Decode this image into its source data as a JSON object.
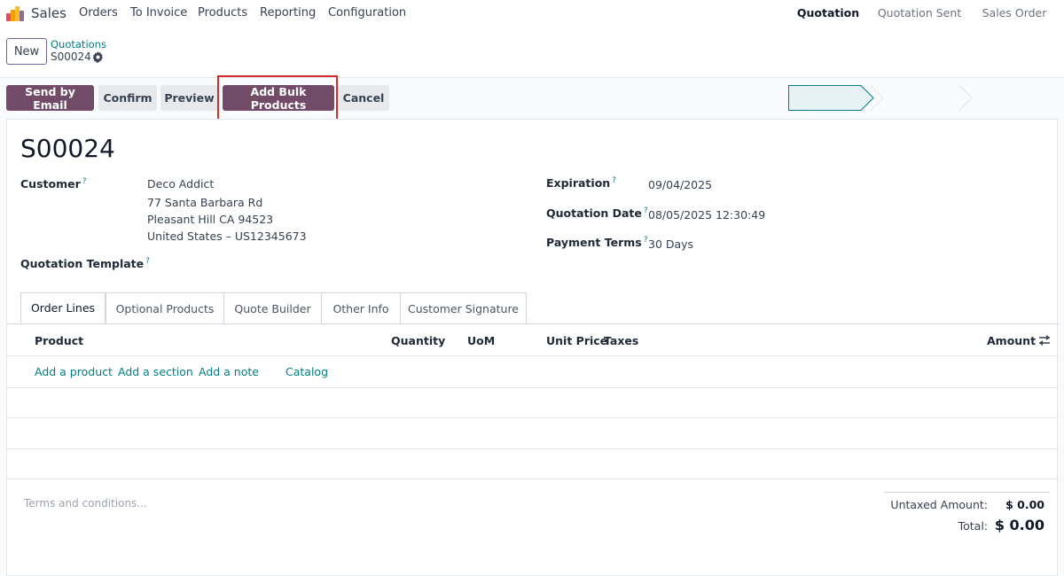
{
  "app": {
    "name": "Sales"
  },
  "nav": [
    "Orders",
    "To Invoice",
    "Products",
    "Reporting",
    "Configuration"
  ],
  "control": {
    "new_label": "New",
    "breadcrumb_parent": "Quotations",
    "breadcrumb_current": "S00024"
  },
  "actions": {
    "send_by_email": "Send by Email",
    "confirm": "Confirm",
    "preview": "Preview",
    "add_bulk_products": "Add Bulk Products",
    "cancel": "Cancel"
  },
  "status_stages": [
    "Quotation",
    "Quotation Sent",
    "Sales Order"
  ],
  "record": {
    "name": "S00024",
    "customer_label": "Customer",
    "customer_name": "Deco Addict",
    "address_line1": "77 Santa Barbara Rd",
    "address_line2": "Pleasant Hill CA 94523",
    "address_line3": "United States – US12345673",
    "template_label": "Quotation Template",
    "expiration_label": "Expiration",
    "expiration_value": "09/04/2025",
    "quotation_date_label": "Quotation Date",
    "quotation_date_value": "08/05/2025 12:30:49",
    "payment_terms_label": "Payment Terms",
    "payment_terms_value": "30 Days",
    "help_mark": "?"
  },
  "tabs": [
    "Order Lines",
    "Optional Products",
    "Quote Builder",
    "Other Info",
    "Customer Signature"
  ],
  "table": {
    "columns": {
      "product": "Product",
      "quantity": "Quantity",
      "uom": "UoM",
      "unit_price": "Unit Price",
      "taxes": "Taxes",
      "amount": "Amount"
    },
    "add_product": "Add a product",
    "add_section": "Add a section",
    "add_note": "Add a note",
    "catalog": "Catalog"
  },
  "terms_placeholder": "Terms and conditions...",
  "totals": {
    "untaxed_label": "Untaxed Amount:",
    "untaxed_value": "$ 0.00",
    "total_label": "Total:",
    "total_value": "$ 0.00"
  },
  "colors": {
    "primary": "#714b67",
    "link": "#017e84",
    "highlight": "#d62b2b"
  }
}
